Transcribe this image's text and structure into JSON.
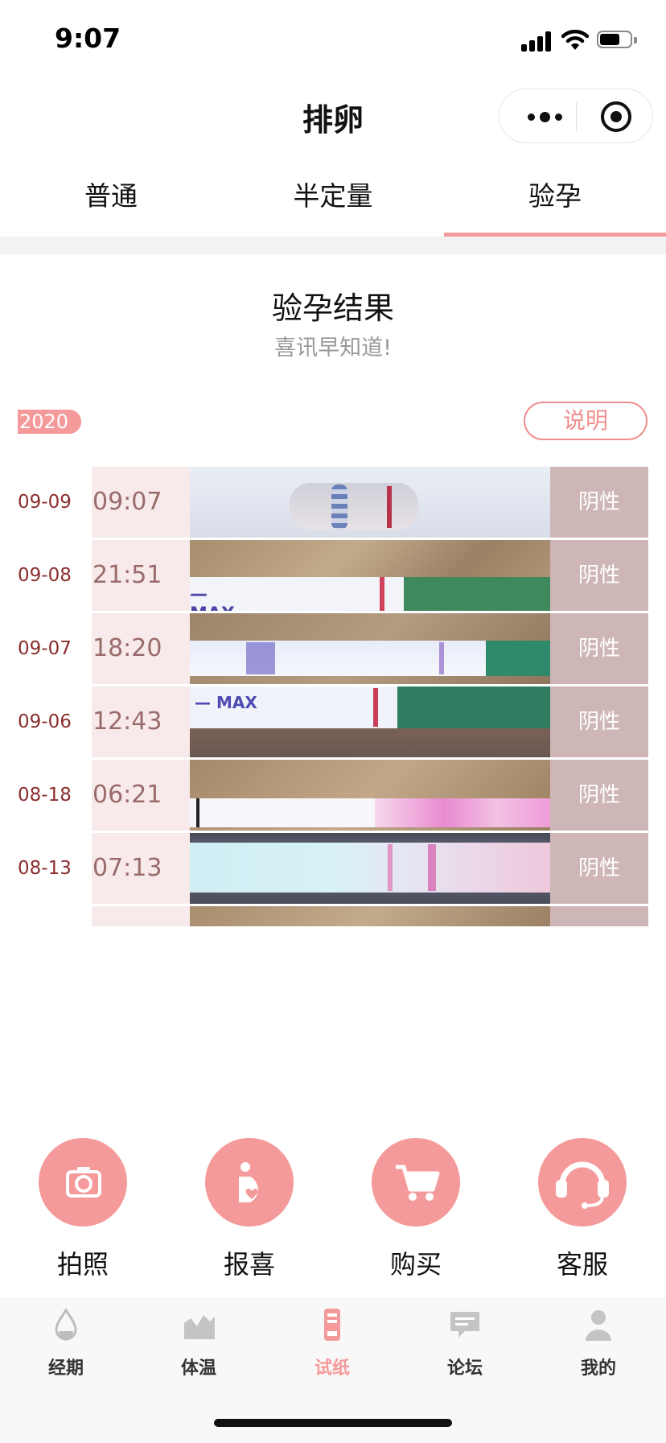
{
  "status_bar": {
    "time": "9:07"
  },
  "nav": {
    "title": "排卵"
  },
  "tabs": [
    {
      "label": "普通",
      "active": false
    },
    {
      "label": "半定量",
      "active": false
    },
    {
      "label": "验孕",
      "active": true
    }
  ],
  "header": {
    "title": "验孕结果",
    "subtitle": "喜讯早知道!"
  },
  "year_badge": "2020",
  "explain_button": "说明",
  "records": [
    {
      "date": "09-09",
      "time": "09:07",
      "result": "阴性"
    },
    {
      "date": "09-08",
      "time": "21:51",
      "result": "阴性"
    },
    {
      "date": "09-07",
      "time": "18:20",
      "result": "阴性"
    },
    {
      "date": "09-06",
      "time": "12:43",
      "result": "阴性"
    },
    {
      "date": "08-18",
      "time": "06:21",
      "result": "阴性"
    },
    {
      "date": "08-13",
      "time": "07:13",
      "result": "阴性"
    }
  ],
  "actions": [
    {
      "label": "拍照",
      "icon": "camera-icon"
    },
    {
      "label": "报喜",
      "icon": "pregnant-icon"
    },
    {
      "label": "购买",
      "icon": "cart-icon"
    },
    {
      "label": "客服",
      "icon": "headset-icon"
    }
  ],
  "tabbar": [
    {
      "label": "经期",
      "icon": "drop-icon",
      "active": false
    },
    {
      "label": "体温",
      "icon": "chart-icon",
      "active": false
    },
    {
      "label": "试纸",
      "icon": "test-strip-icon",
      "active": true
    },
    {
      "label": "论坛",
      "icon": "chat-icon",
      "active": false
    },
    {
      "label": "我的",
      "icon": "user-icon",
      "active": false
    }
  ],
  "colors": {
    "accent": "#f59a9a",
    "result_bg": "#cfb6b6",
    "time_bg": "#f8eaea"
  }
}
